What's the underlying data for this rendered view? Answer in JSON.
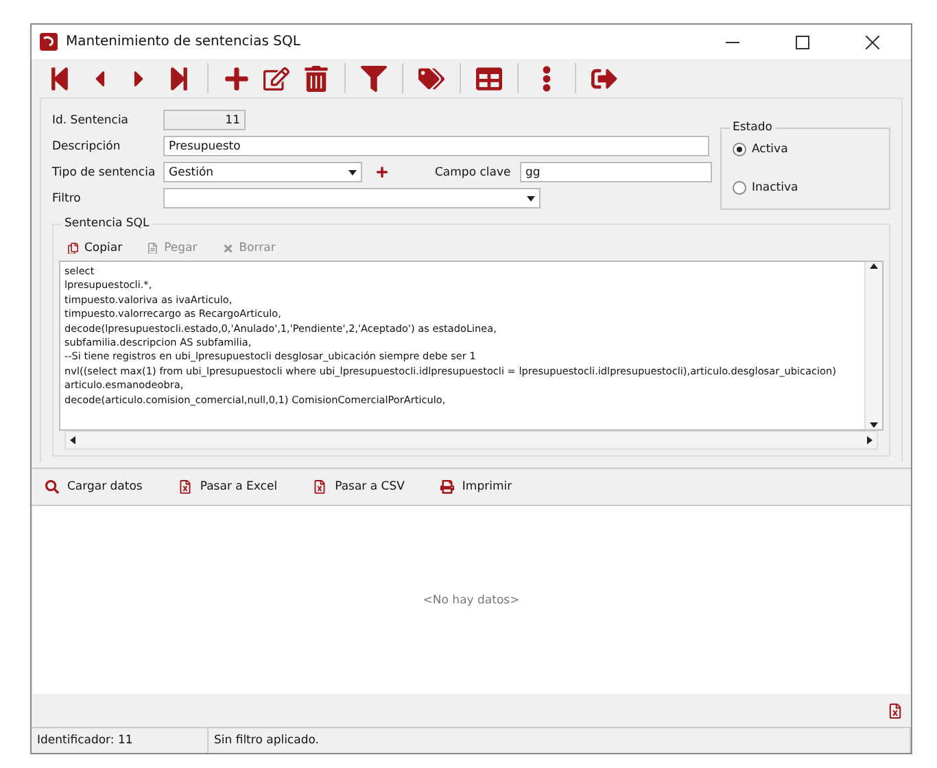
{
  "window": {
    "title": "Mantenimiento de sentencias SQL"
  },
  "form": {
    "id_label": "Id. Sentencia",
    "id_value": "11",
    "descripcion_label": "Descripción",
    "descripcion_value": "Presupuesto",
    "tipo_label": "Tipo de sentencia",
    "tipo_value": "Gestión",
    "campo_label": "Campo clave",
    "campo_value": "gg",
    "filtro_label": "Filtro"
  },
  "estado": {
    "title": "Estado",
    "options": [
      {
        "label": "Activa",
        "selected": true
      },
      {
        "label": "Inactiva",
        "selected": false
      }
    ]
  },
  "sql": {
    "title": "Sentencia SQL",
    "actions": [
      {
        "kind": "copy",
        "label": "Copiar",
        "disabled": false
      },
      {
        "kind": "paste",
        "label": "Pegar",
        "disabled": true
      },
      {
        "kind": "clear",
        "label": "Borrar",
        "disabled": true
      }
    ],
    "lines": [
      "select",
      "lpresupuestocli.*,",
      "timpuesto.valoriva as ivaArticulo,",
      "timpuesto.valorrecargo as RecargoArticulo,",
      "decode(lpresupuestocli.estado,0,'Anulado',1,'Pendiente',2,'Aceptado') as estadoLinea,",
      "subfamilia.descripcion AS subfamilia,",
      "--Si tiene registros en ubi_lpresupuestocli desglosar_ubicación siempre debe ser 1",
      "nvl((select max(1) from ubi_lpresupuestocli where ubi_lpresupuestocli.idlpresupuestocli = lpresupuestocli.idlpresupuestocli),articulo.desglosar_ubicacion)",
      "articulo.esmanodeobra,",
      "decode(articulo.comision_comercial,null,0,1) ComisionComercialPorArticulo,"
    ]
  },
  "data_toolbar": [
    {
      "kind": "load",
      "label": "Cargar datos"
    },
    {
      "kind": "excel",
      "label": "Pasar a Excel"
    },
    {
      "kind": "csv",
      "label": "Pasar a CSV"
    },
    {
      "kind": "print",
      "label": "Imprimir"
    }
  ],
  "grid": {
    "empty_text": "<No hay datos>"
  },
  "status_bar": [
    "Identificador: 11",
    "Sin filtro aplicado."
  ]
}
